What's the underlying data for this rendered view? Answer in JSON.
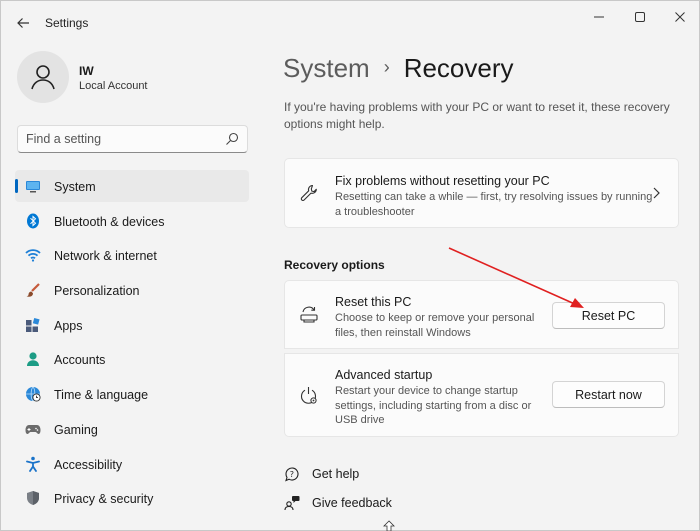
{
  "app": {
    "title": "Settings"
  },
  "profile": {
    "name": "IW",
    "account_type": "Local Account"
  },
  "search": {
    "placeholder": "Find a setting"
  },
  "sidebar": {
    "items": [
      {
        "label": "System",
        "icon": "laptop-icon",
        "active": true
      },
      {
        "label": "Bluetooth & devices",
        "icon": "bluetooth-icon"
      },
      {
        "label": "Network & internet",
        "icon": "wifi-icon"
      },
      {
        "label": "Personalization",
        "icon": "brush-icon"
      },
      {
        "label": "Apps",
        "icon": "apps-icon"
      },
      {
        "label": "Accounts",
        "icon": "person-icon"
      },
      {
        "label": "Time & language",
        "icon": "globe-clock-icon"
      },
      {
        "label": "Gaming",
        "icon": "gamepad-icon"
      },
      {
        "label": "Accessibility",
        "icon": "accessibility-icon"
      },
      {
        "label": "Privacy & security",
        "icon": "shield-icon"
      }
    ]
  },
  "breadcrumb": {
    "parent": "System",
    "separator": "›",
    "current": "Recovery"
  },
  "intro": "If you're having problems with your PC or want to reset it, these recovery options might help.",
  "fix_card": {
    "title": "Fix problems without resetting your PC",
    "description": "Resetting can take a while — first, try resolving issues by running a troubleshooter"
  },
  "recovery_options": {
    "heading": "Recovery options",
    "reset": {
      "title": "Reset this PC",
      "description": "Choose to keep or remove your personal files, then reinstall Windows",
      "button": "Reset PC"
    },
    "advanced": {
      "title": "Advanced startup",
      "description": "Restart your device to change startup settings, including starting from a disc or USB drive",
      "button": "Restart now"
    }
  },
  "links": {
    "help": "Get help",
    "feedback": "Give feedback"
  },
  "colors": {
    "accent": "#0067c0",
    "annotation_arrow": "#e02020"
  }
}
